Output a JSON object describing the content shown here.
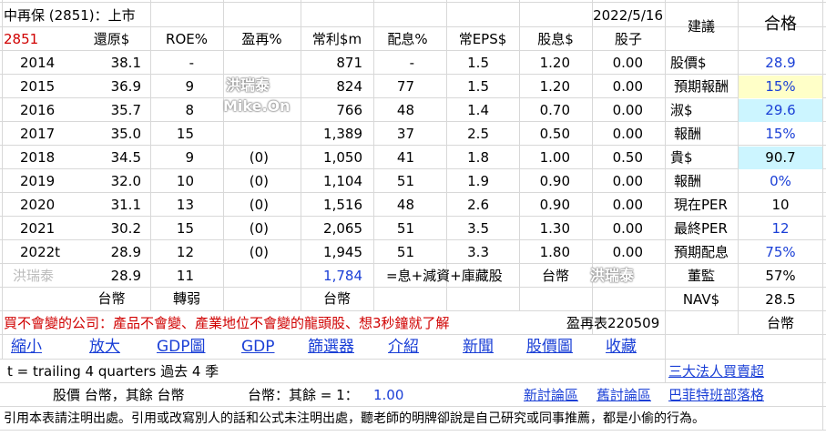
{
  "header": {
    "company": "中再保 (2851)：上市",
    "date": "2022/5/16",
    "advice_label": "建議",
    "advice_value": "合格"
  },
  "columns": [
    "2851",
    "還原$",
    "ROE%",
    "盈再%",
    "常利$m",
    "配息%",
    "常EPS$",
    "股息$",
    "股子"
  ],
  "rows": [
    {
      "year": "2014",
      "restore": "38.1",
      "roe": "-",
      "reinvest": "",
      "profit": "871",
      "payout": "-",
      "eps": "1.5",
      "div": "1.20",
      "stock": "0.00"
    },
    {
      "year": "2015",
      "restore": "36.9",
      "roe": "9",
      "reinvest": "",
      "profit": "824",
      "payout": "77",
      "eps": "1.5",
      "div": "1.20",
      "stock": "0.00"
    },
    {
      "year": "2016",
      "restore": "35.7",
      "roe": "8",
      "reinvest": "",
      "profit": "766",
      "payout": "48",
      "eps": "1.4",
      "div": "0.70",
      "stock": "0.00"
    },
    {
      "year": "2017",
      "restore": "35.0",
      "roe": "15",
      "reinvest": "",
      "profit": "1,389",
      "payout": "37",
      "eps": "2.5",
      "div": "0.50",
      "stock": "0.00"
    },
    {
      "year": "2018",
      "restore": "34.5",
      "roe": "9",
      "reinvest": "(0)",
      "profit": "1,050",
      "payout": "41",
      "eps": "1.8",
      "div": "1.00",
      "stock": "0.50"
    },
    {
      "year": "2019",
      "restore": "32.0",
      "roe": "10",
      "reinvest": "(0)",
      "profit": "1,104",
      "payout": "51",
      "eps": "1.9",
      "div": "0.90",
      "stock": "0.00"
    },
    {
      "year": "2020",
      "restore": "31.1",
      "roe": "13",
      "reinvest": "(0)",
      "profit": "1,516",
      "payout": "48",
      "eps": "2.6",
      "div": "0.90",
      "stock": "0.00"
    },
    {
      "year": "2021",
      "restore": "30.2",
      "roe": "15",
      "reinvest": "(0)",
      "profit": "2,065",
      "payout": "51",
      "eps": "3.5",
      "div": "1.30",
      "stock": "0.00"
    },
    {
      "year": "2022t",
      "restore": "28.9",
      "roe": "12",
      "reinvest": "(0)",
      "profit": "1,945",
      "payout": "51",
      "eps": "3.3",
      "div": "1.80",
      "stock": "0.00"
    }
  ],
  "summary": {
    "watermark_text": "洪瑞泰",
    "restore": "28.9",
    "roe": "11",
    "profit": "1,784",
    "formula": "=息+減資+庫藏股",
    "currency": "台幣"
  },
  "units": {
    "restore": "台幣",
    "roe": "轉弱",
    "profit": "台幣"
  },
  "right_panel": [
    {
      "label": "股價$",
      "value": "28.9"
    },
    {
      "label": "預期報酬",
      "value": "15%"
    },
    {
      "label": "淑$",
      "value": "29.6"
    },
    {
      "label": "報酬",
      "value": "15%"
    },
    {
      "label": "貴$",
      "value": "90.7"
    },
    {
      "label": "報酬",
      "value": "0%"
    },
    {
      "label": "現在PER",
      "value": "10"
    },
    {
      "label": "最終PER",
      "value": "12"
    },
    {
      "label": "預期配息",
      "value": "75%"
    },
    {
      "label": "董監",
      "value": "57%"
    },
    {
      "label": "NAV$",
      "value": "28.5"
    }
  ],
  "right_unit": "台幣",
  "watermarks": {
    "a": "洪瑞泰",
    "b": "Mike.On",
    "c": "洪瑞泰"
  },
  "note_red": "買不會變的公司：產品不會變、產業地位不會變的龍頭股、想3秒鐘就了解",
  "sheet_name": "盈再表220509",
  "nav_links": [
    "縮小",
    "放大",
    "GDP圖",
    "GDP",
    "篩選器",
    "介紹",
    "新聞",
    "股價圖",
    "收藏"
  ],
  "trailing_note": "t = trailing 4 quarters 過去 4 季",
  "institutional_link": "三大法人買賣超",
  "currency_row": {
    "left": "股價 台幣，其餘 台幣",
    "mid": "台幣：其餘 = 1：",
    "rate": "1.00",
    "link_new": "新討論區",
    "link_old": "舊討論區",
    "link_buffett": "巴菲特班部落格"
  },
  "footer": "引用本表請注明出處。引用或改寫別人的話和公式未注明出處，聽老師的明牌卻說是自己研究或同事推薦，都是小偷的行為。",
  "colors": {
    "accent_blue": "#1a3fd6",
    "red": "#d00000",
    "highlight_yellow": "#ffffc8",
    "highlight_cyan": "#ccf5ff"
  }
}
